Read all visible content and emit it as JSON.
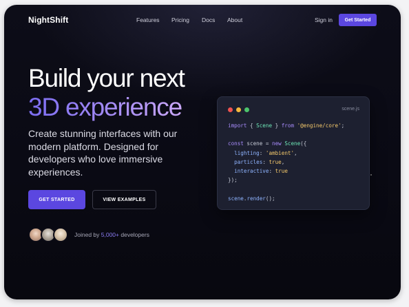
{
  "nav": {
    "logo": "NightShift",
    "links": [
      "Features",
      "Pricing",
      "Docs",
      "About"
    ],
    "signin": "Sign in",
    "cta": "Get Started"
  },
  "hero": {
    "title_line1": "Build your next",
    "title_line2": "3D experience",
    "description": "Create stunning interfaces with our modern platform. Designed for developers who love immersive experiences.",
    "primary_button": "GET STARTED",
    "secondary_button": "VIEW EXAMPLES",
    "social_proof": {
      "prefix": "Joined by ",
      "count": "5,000+",
      "suffix": " developers"
    }
  },
  "code_card": {
    "filename": "scene.js",
    "lines": [
      [
        {
          "t": "import",
          "c": "kw"
        },
        {
          "t": " { "
        },
        {
          "t": "Scene",
          "c": "cls"
        },
        {
          "t": " } "
        },
        {
          "t": "from",
          "c": "kw"
        },
        {
          "t": " "
        },
        {
          "t": "'@engine/core'",
          "c": "str"
        },
        {
          "t": ";"
        }
      ],
      [
        {
          "t": ""
        }
      ],
      [
        {
          "t": "const",
          "c": "kw"
        },
        {
          "t": " scene = "
        },
        {
          "t": "new",
          "c": "kw"
        },
        {
          "t": " "
        },
        {
          "t": "Scene",
          "c": "cls"
        },
        {
          "t": "({"
        }
      ],
      [
        {
          "t": "  "
        },
        {
          "t": "lighting",
          "c": "prop"
        },
        {
          "t": ": "
        },
        {
          "t": "'ambient'",
          "c": "str"
        },
        {
          "t": ","
        }
      ],
      [
        {
          "t": "  "
        },
        {
          "t": "particles",
          "c": "prop"
        },
        {
          "t": ": "
        },
        {
          "t": "true",
          "c": "bool"
        },
        {
          "t": ","
        }
      ],
      [
        {
          "t": "  "
        },
        {
          "t": "interactive",
          "c": "prop"
        },
        {
          "t": ": "
        },
        {
          "t": "true",
          "c": "bool"
        }
      ],
      [
        {
          "t": "});"
        }
      ],
      [
        {
          "t": ""
        }
      ],
      [
        {
          "t": "scene",
          "c": "prop"
        },
        {
          "t": "."
        },
        {
          "t": "render",
          "c": "prop"
        },
        {
          "t": "();"
        }
      ]
    ]
  },
  "colors": {
    "accent": "#5b47e0",
    "background": "#0a0a14",
    "gradient_start": "#7c6df2",
    "gradient_end": "#c9a7f7"
  }
}
